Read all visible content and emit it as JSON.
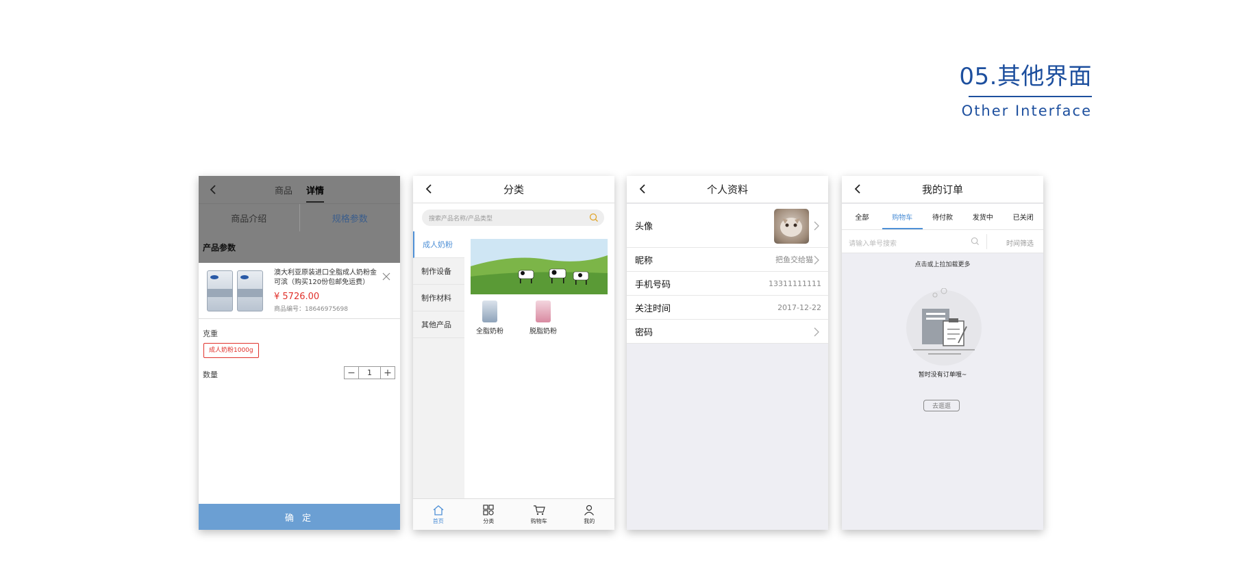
{
  "heading": {
    "title": "05.其他界面",
    "subtitle": "Other Interface",
    "accent": "#1d4f9e"
  },
  "screen1": {
    "tabs": [
      "商品",
      "详情"
    ],
    "subtabs": [
      "商品介绍",
      "规格参数"
    ],
    "section_title": "产品参数",
    "product": {
      "name": "澳大利亚原装进口全脂成人奶粉金可滨（购买120份包邮免运费）",
      "price": "¥ 5726.00",
      "code": "商品编号：18646975698"
    },
    "weight_label": "克重",
    "weight_option": "成人奶粉1000g",
    "qty_label": "数量",
    "qty_value": "1",
    "qty_minus": "−",
    "qty_plus": "+",
    "confirm": "确 定",
    "confirm_color": "#6b9fd3"
  },
  "screen2": {
    "title": "分类",
    "search_placeholder": "搜索产品名称/产品类型",
    "categories": [
      "成人奶粉",
      "制作设备",
      "制作材料",
      "其他产品"
    ],
    "products": [
      "全脂奶粉",
      "脱脂奶粉"
    ],
    "tabbar": [
      "首页",
      "分类",
      "购物车",
      "我的"
    ],
    "accent": "#4d8fd6"
  },
  "screen3": {
    "title": "个人资料",
    "rows": [
      {
        "label": "头像",
        "value": ""
      },
      {
        "label": "昵称",
        "value": "把鱼交给猫"
      },
      {
        "label": "手机号码",
        "value": "13311111111"
      },
      {
        "label": "关注时间",
        "value": "2017-12-22"
      },
      {
        "label": "密码",
        "value": ""
      }
    ]
  },
  "screen4": {
    "title": "我的订单",
    "tabs": [
      "全部",
      "购物车",
      "待付款",
      "发货中",
      "已关闭"
    ],
    "search_placeholder": "请输入单号搜索",
    "time_filter": "时间筛选",
    "load_more": "点击或上拉加载更多",
    "empty_text": "暂时没有订单哦~",
    "go_button": "去逛逛"
  }
}
